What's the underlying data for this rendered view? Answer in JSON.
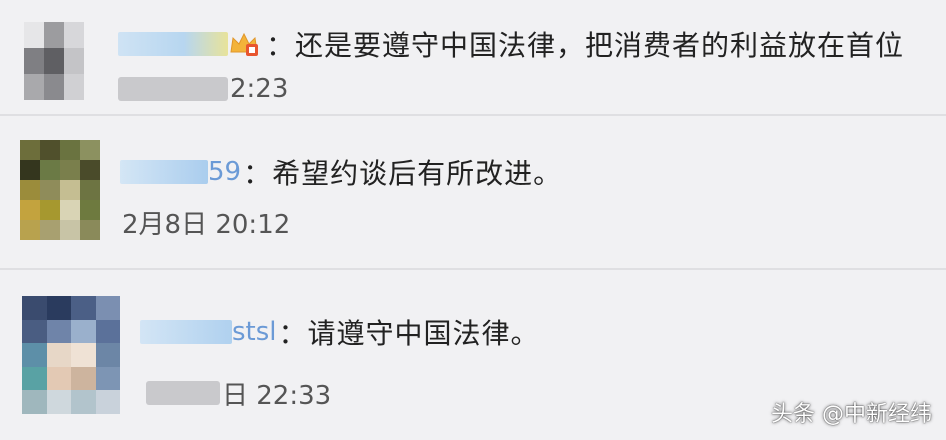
{
  "comments": [
    {
      "username_visible_suffix": "",
      "text": "：还是要遵守中国法律，把消费者的利益放在首位",
      "timestamp_visible": "2:23"
    },
    {
      "username_visible_suffix": "59",
      "text": "：希望约谈后有所改进。",
      "timestamp_visible": "2月8日 20:12"
    },
    {
      "username_visible_suffix": "stsl",
      "text": "：请遵守中国法律。",
      "timestamp_visible": "日 22:33"
    }
  ],
  "watermark": "头条 @中新经纬",
  "colors": {
    "background": "#f1f1f3",
    "username_blur": "#b9d8f2",
    "username_text": "#6b9ad6",
    "comment_text": "#222222",
    "timestamp_text": "#555555",
    "divider": "#dfdfe2",
    "badge": "#f3b339"
  },
  "icons": [
    "vip-crown-badge-icon"
  ]
}
